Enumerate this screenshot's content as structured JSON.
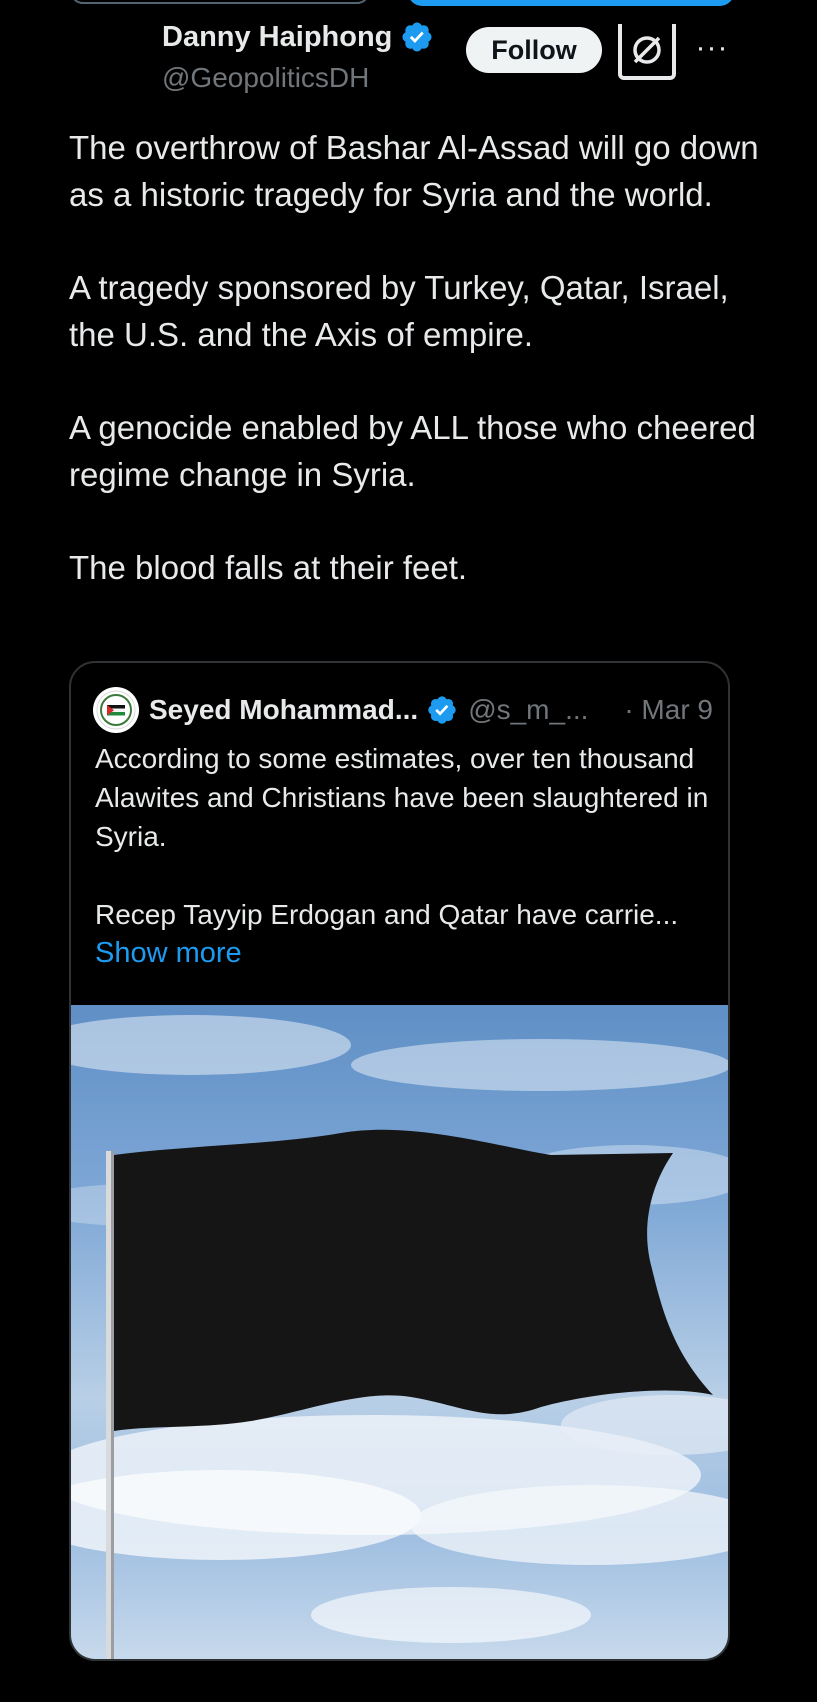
{
  "author": {
    "display_name": "Danny Haiphong",
    "handle": "@GeopoliticsDH",
    "verified_icon": "verified-badge-icon"
  },
  "actions": {
    "follow_label": "Follow",
    "grok_icon": "grok-icon",
    "more_icon": "more-options-icon"
  },
  "tweet": {
    "paragraphs": [
      "The overthrow of Bashar Al-Assad will go down as a historic tragedy for Syria and the world.",
      "A tragedy sponsored by Turkey, Qatar, Israel, the U.S. and the Axis of empire.",
      "A genocide enabled by ALL those who cheered regime change in Syria.",
      "The blood falls at their feet."
    ]
  },
  "quote": {
    "display_name": "Seyed Mohammad...",
    "handle": "@s_m_...",
    "date": "· Mar 9",
    "paragraphs": [
      "According to some estimates, over ten thousand Alawites and Christians have been slaughtered in Syria.",
      "Recep Tayyip Erdogan and Qatar have carrie..."
    ],
    "show_more_label": "Show more",
    "media_icon": "black-flag-image"
  },
  "colors": {
    "background": "#000000",
    "text": "#e7e9ea",
    "muted": "#71767b",
    "accent": "#1d9bf0",
    "border": "#2f3336"
  }
}
